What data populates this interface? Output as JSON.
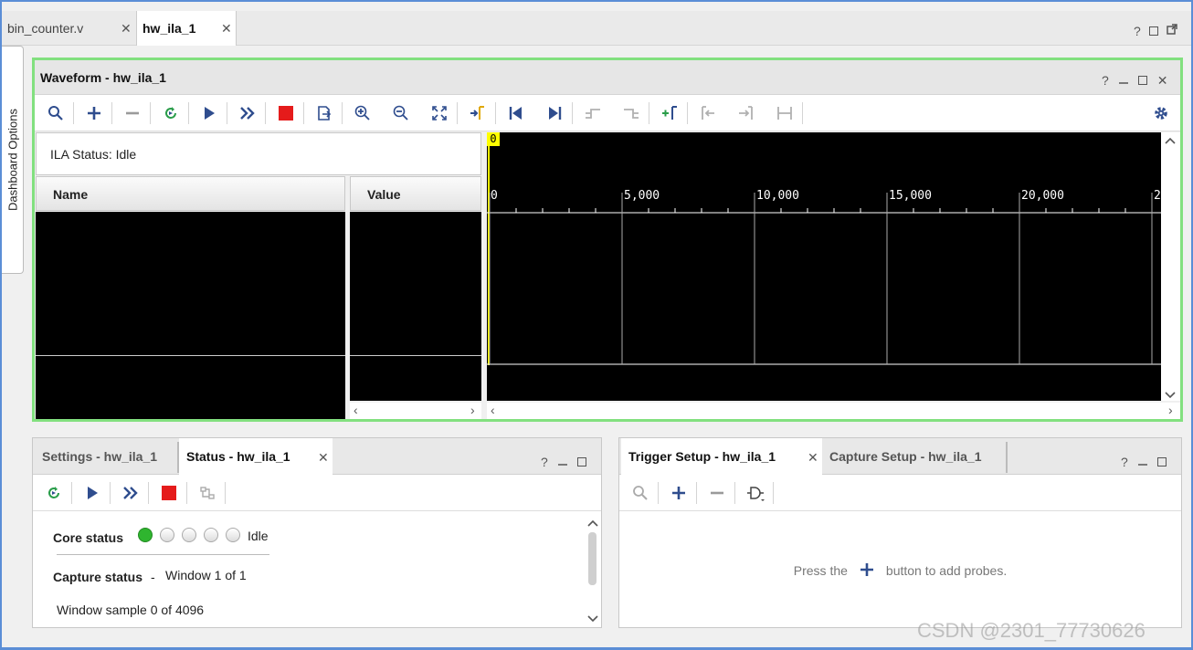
{
  "tabs": [
    {
      "label": "bin_counter.v"
    },
    {
      "label": "hw_ila_1"
    }
  ],
  "window_controls": {
    "help": "?"
  },
  "dashboard": {
    "label": "Dashboard Options"
  },
  "waveform": {
    "title": "Waveform - hw_ila_1",
    "ila_status": "ILA Status:  Idle",
    "columns": {
      "name": "Name",
      "value": "Value"
    },
    "cursor_label": "0",
    "ruler_ticks": [
      "0",
      "5,000",
      "10,000",
      "15,000",
      "20,000",
      "2"
    ]
  },
  "toolbar_icons": [
    "search-icon",
    "add-icon",
    "remove-icon",
    "refresh-icon",
    "run-icon",
    "run-immediate-icon",
    "stop-icon",
    "export-icon",
    "zoom-in-icon",
    "zoom-out-icon",
    "zoom-fit-icon",
    "go-to-cursor-icon",
    "go-to-start-icon",
    "go-to-end-icon",
    "prev-transition-icon",
    "next-transition-icon",
    "add-marker-icon",
    "prev-marker-icon",
    "next-marker-icon",
    "swap-cursors-icon",
    "settings-icon"
  ],
  "status_panel": {
    "tabs": [
      {
        "label": "Settings - hw_ila_1"
      },
      {
        "label": "Status - hw_ila_1"
      }
    ],
    "core_status_label": "Core status",
    "core_status_value": "Idle",
    "capture_status_label": "Capture status",
    "capture_status_sep": "-",
    "capture_status_value": "Window 1 of 1",
    "window_sample": "Window sample 0 of 4096"
  },
  "trigger_panel": {
    "tabs": [
      {
        "label": "Trigger Setup - hw_ila_1"
      },
      {
        "label": "Capture Setup - hw_ila_1"
      }
    ],
    "hint_before": "Press the",
    "hint_after": "button to add probes."
  },
  "watermark": "CSDN @2301_77730626",
  "colors": {
    "accent_green": "#82e07f",
    "frame_blue": "#5b8ed6",
    "toolbar_blue": "#2f4d8e",
    "stop_red": "#e51b1b",
    "cursor_yellow": "#ffff00",
    "status_green": "#2fb52f"
  }
}
